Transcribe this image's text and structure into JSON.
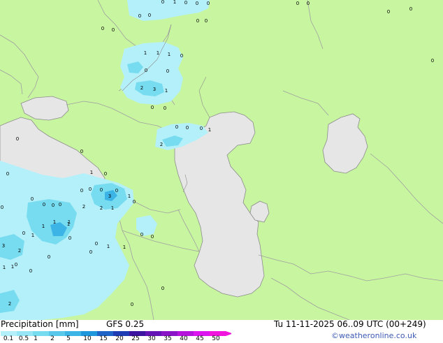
{
  "title": "Precipitation [mm]",
  "model": "GFS 0.25",
  "valid_time": "Tu 11-11-2025 06..09 UTC (00+249)",
  "credit": "©weatheronline.co.uk",
  "legend": {
    "labels": [
      "0.1",
      "0.5",
      "1",
      "2",
      "5",
      "10",
      "15",
      "20",
      "25",
      "30",
      "35",
      "40",
      "45",
      "50"
    ],
    "colors": [
      "#b4f0fa",
      "#96e6f5",
      "#78dcf0",
      "#5ac8eb",
      "#3cb4e6",
      "#1e96dc",
      "#1e64c8",
      "#1e3cb4",
      "#3c14a0",
      "#6414b4",
      "#8c14c8",
      "#b414dc",
      "#dc14f0",
      "#f014dc"
    ]
  },
  "colors": {
    "land": "#c8f5a0",
    "water": "#e6e6e6",
    "border": "#a0a0a0",
    "coast": "#8c8c8c",
    "precip_light": "#b4f0fa",
    "precip_mid": "#78dcf0",
    "precip_heavy": "#3cb4e6"
  },
  "values": [
    {
      "t": "0"
    },
    {
      "t": "1"
    },
    {
      "t": "0"
    },
    {
      "t": "0"
    },
    {
      "t": "0"
    },
    {
      "t": "0"
    },
    {
      "t": "0"
    },
    {
      "t": "0"
    },
    {
      "t": "0"
    },
    {
      "t": "0"
    },
    {
      "t": "0"
    },
    {
      "t": "0"
    },
    {
      "t": "1"
    },
    {
      "t": "1"
    },
    {
      "t": "1"
    },
    {
      "t": "0"
    },
    {
      "t": "0"
    },
    {
      "t": "0"
    },
    {
      "t": "0"
    },
    {
      "t": "0"
    },
    {
      "t": "2"
    },
    {
      "t": "3"
    },
    {
      "t": "1"
    },
    {
      "t": "0"
    },
    {
      "t": "0"
    },
    {
      "t": "0"
    },
    {
      "t": "0"
    },
    {
      "t": "0"
    },
    {
      "t": "1"
    },
    {
      "t": "2"
    },
    {
      "t": "0"
    },
    {
      "t": "0"
    },
    {
      "t": "1"
    },
    {
      "t": "0"
    },
    {
      "t": "0"
    },
    {
      "t": "0"
    },
    {
      "t": "0"
    },
    {
      "t": "0"
    },
    {
      "t": "0"
    },
    {
      "t": "0"
    },
    {
      "t": "0"
    },
    {
      "t": "3"
    },
    {
      "t": "1"
    },
    {
      "t": "0"
    },
    {
      "t": "1"
    },
    {
      "t": "1"
    },
    {
      "t": "1"
    },
    {
      "t": "1"
    },
    {
      "t": "2"
    },
    {
      "t": "2"
    },
    {
      "t": "1"
    },
    {
      "t": "0"
    },
    {
      "t": "0"
    },
    {
      "t": "1"
    },
    {
      "t": "1"
    },
    {
      "t": "0"
    },
    {
      "t": "0"
    },
    {
      "t": "1"
    },
    {
      "t": "0"
    },
    {
      "t": "3"
    },
    {
      "t": "2"
    },
    {
      "t": "1"
    },
    {
      "t": "1"
    },
    {
      "t": "0"
    },
    {
      "t": "0"
    },
    {
      "t": "0"
    },
    {
      "t": "0"
    },
    {
      "t": "0"
    },
    {
      "t": "0"
    },
    {
      "t": "0"
    },
    {
      "t": "2"
    },
    {
      "t": "0"
    },
    {
      "t": "0"
    },
    {
      "t": "0"
    },
    {
      "t": "0"
    }
  ]
}
